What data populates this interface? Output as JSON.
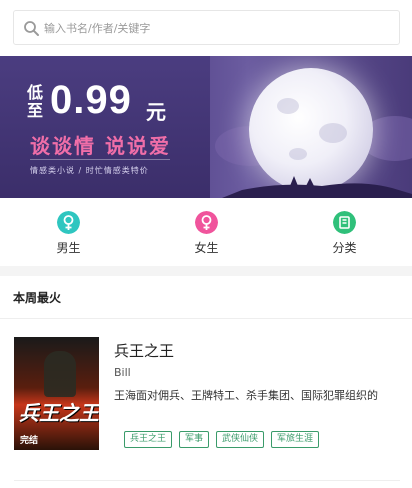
{
  "search": {
    "placeholder": "输入书名/作者/关键字"
  },
  "banner": {
    "price_prefix": "低至",
    "price": "0.99",
    "price_unit": "元",
    "slogan": "谈谈情  说说爱",
    "subtitle": "情感类小说 / 时忙情感类特价"
  },
  "nav": [
    {
      "label": "男生",
      "icon": "male-icon",
      "color": "#2fc6c0"
    },
    {
      "label": "女生",
      "icon": "female-icon",
      "color": "#f0549c"
    },
    {
      "label": "分类",
      "icon": "book-category-icon",
      "color": "#2fc07a"
    }
  ],
  "section": {
    "title": "本周最火"
  },
  "book": {
    "title": "兵王之王",
    "author": "Bill",
    "description": "王海面对佣兵、王牌特工、杀手集团、国际犯罪组织的",
    "cover_title": "兵王之王",
    "cover_badge": "完结",
    "tags": [
      "兵王之王",
      "军事",
      "武侠仙侠",
      "军旅生涯"
    ]
  },
  "colors": {
    "tag_green": "#3a9b6a",
    "banner_purple": "#4b3d80",
    "slogan_pink": "#f06ea8"
  }
}
